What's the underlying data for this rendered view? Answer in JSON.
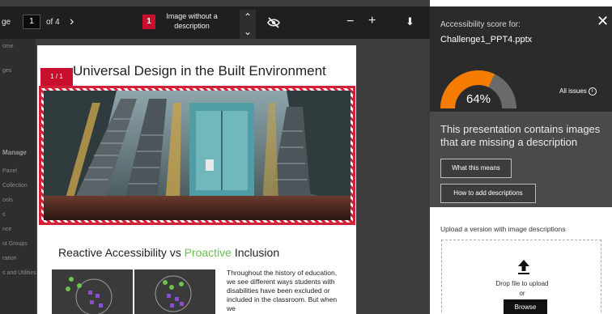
{
  "toolbar": {
    "page_label": "ge",
    "page_number": "1",
    "page_total": "of 4",
    "next_icon": "›",
    "issue_count": "1",
    "issue_label": "Image without a description",
    "up_icon": "⌃",
    "down_icon": "⌄",
    "zoom_out": "−",
    "zoom_in": "+",
    "download_icon": "⬇"
  },
  "side_nav": {
    "items": [
      "ome",
      "ges"
    ],
    "heading": "Manage",
    "sub_items": [
      "Panel",
      "Collection",
      "ools",
      "s",
      "nce",
      "nt Groups",
      "ration",
      "s and Utilities"
    ]
  },
  "slide1": {
    "title": "Universal Design in the Built Environment",
    "count_badge": "1 / 1"
  },
  "slide2": {
    "title_before": "Reactive Accessibility vs ",
    "title_highlight": "Proactive",
    "title_after": " Inclusion",
    "body": "Throughout the history of education, we see different ways students with disabilities have been excluded or included in the classroom. But when we"
  },
  "panel": {
    "score_label": "Accessibility score for:",
    "file_name": "Challenge1_PPT4.pptx",
    "close": "✕",
    "score": "64%",
    "score_value": 64,
    "all_issues": "All issues",
    "info": "i",
    "message": "This presentation contains images that are missing a description",
    "btn_what": "What this means",
    "btn_how": "How to add descriptions",
    "upload_label": "Upload a version with image descriptions",
    "drop_text": "Drop file to upload",
    "or_text": "or",
    "browse": "Browse"
  },
  "colors": {
    "accent_red": "#c8102e",
    "gauge_orange": "#f57c00",
    "gauge_track": "#6a6a6a",
    "highlight_green": "#6cc24a"
  }
}
